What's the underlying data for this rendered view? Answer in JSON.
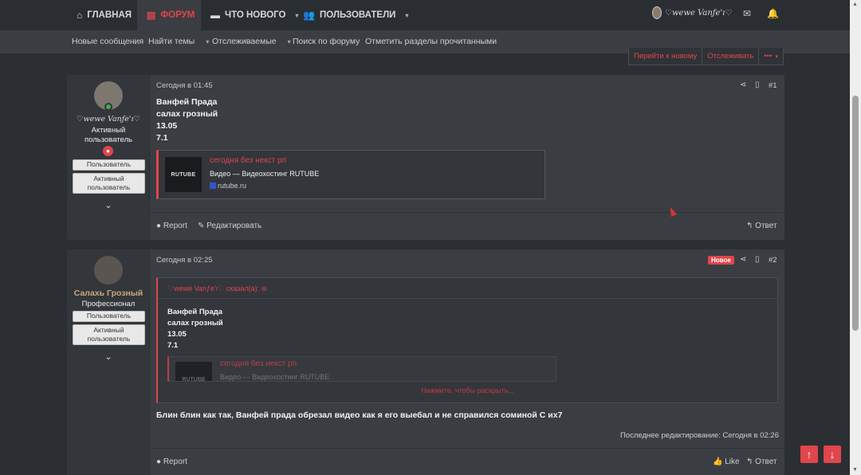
{
  "nav": {
    "home": "ГЛАВНАЯ",
    "forum": "ФОРУМ",
    "whats_new": "ЧТО НОВОГО",
    "users": "ПОЛЬЗОВАТЕЛИ",
    "username": "♡wewe Vanƒe'ı♡"
  },
  "subnav": {
    "new_messages": "Новые сообщения",
    "find_threads": "Найти темы",
    "watched": "Отслеживаемые",
    "search_forum": "Поиск по форуму",
    "mark_read": "Отметить разделы прочитанными"
  },
  "thread_buttons": {
    "go_new": "Перейти к новому",
    "watch": "Отслеживать",
    "more": "•••"
  },
  "post1": {
    "author": "♡wewe Vanƒe'ı♡",
    "title_line1": "Активный",
    "title_line2": "пользователь",
    "badge1": "Пользователь",
    "badge2_line1": "Активный",
    "badge2_line2": "пользователь",
    "date": "Сегодня в 01:45",
    "number": "#1",
    "text": [
      "Ванфей Прада",
      "салах грозный",
      "13.05",
      "7.1"
    ],
    "embed": {
      "title": "сегодня без некст рп",
      "subtitle": "Видео — Видеохостинг RUTUBE",
      "domain": "rutube.ru",
      "img_label": "RUTUBE"
    },
    "report": "Report",
    "edit": "Редактировать",
    "reply": "Ответ"
  },
  "post2": {
    "author": "Салахь Грозный",
    "title": "Профессионал",
    "badge1": "Пользователь",
    "badge2_line1": "Активный",
    "badge2_line2": "пользователь",
    "date": "Сегодня в 02:25",
    "new_label": "Новое",
    "number": "#2",
    "quote": {
      "header": "♡wewe Vanƒe'ı♡ сказал(а):",
      "text": [
        "Ванфей Прада",
        "салах грозный",
        "13.05",
        "7.1"
      ],
      "embed_title": "сегодня без некст рп",
      "embed_subtitle": "Видео — Видеохостинг RUTUBE",
      "img_label": "RUTUBE",
      "expand": "Нажмите, чтобы раскрыть..."
    },
    "message": "Блин блин как так, Ванфей прада обрезал видео как я его выебал и не справился соминой С их7",
    "last_edit": "Последнее редактирование: Сегодня в 02:26",
    "report": "Report",
    "like": "Like",
    "reply": "Ответ"
  },
  "colors": {
    "accent": "#e0464b",
    "bg": "#2b2e33",
    "panel": "#3a3d42"
  }
}
